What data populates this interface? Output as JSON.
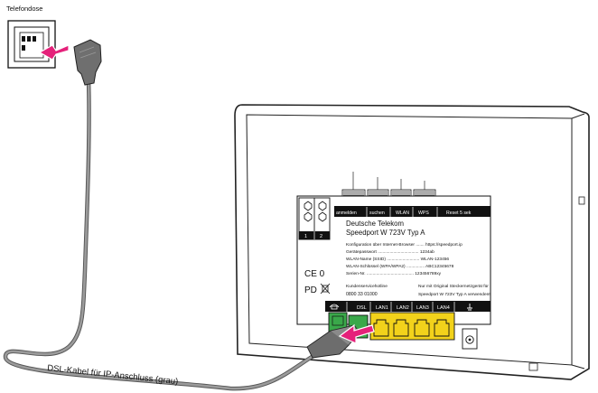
{
  "labels": {
    "socket": "Telefondose",
    "cable": "DSL-Kabel für IP-Anschluss (grau)"
  },
  "router": {
    "buttons": [
      "anmelden",
      "suchen",
      "WLAN",
      "WPS",
      "Reset 5 sek"
    ],
    "sim_slots": [
      "1",
      "2"
    ],
    "maker": "Deutsche Telekom",
    "model": "Speedport W 723V Typ A",
    "config_lines": [
      "Konfiguration über Internet-Browser ....... https://speedport.ip",
      "Gerätepasswort .................................. 1234ab",
      "WLAN-Name (SSID) ........................... WLAN-123456",
      "WLAN-Schlüssel (WPA/WPA2) ............... ABC12345678",
      "Serien-Nr. ....................................... 123456789xy"
    ],
    "hotline_label": "Kundenservicehotline",
    "hotline_number": "0800 33 01000",
    "power_note_1": "Nur mit Original Steckernetzgerät für",
    "power_note_2": "Speedport W 723V Typ A verwenden!",
    "ports": [
      "DSL",
      "LAN1",
      "LAN2",
      "LAN3",
      "LAN4"
    ],
    "marks": {
      "ce": "CE 0",
      "pd": "PD"
    }
  },
  "colors": {
    "dsl_port": "#3aa84a",
    "lan_port": "#f2d21b",
    "arrow": "#e5217a",
    "cable": "#8c8c8c"
  }
}
